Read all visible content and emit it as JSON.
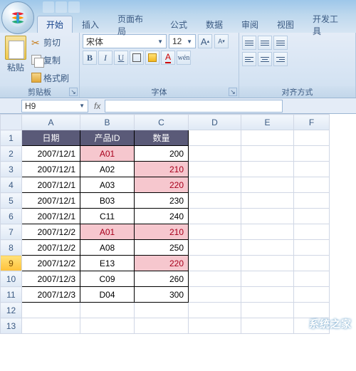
{
  "tabs": [
    "开始",
    "插入",
    "页面布局",
    "公式",
    "数据",
    "审阅",
    "视图",
    "开发工具"
  ],
  "activeTab": 0,
  "clipboard": {
    "paste": "粘贴",
    "cut": "剪切",
    "copy": "复制",
    "fmt": "格式刷",
    "group": "剪贴板"
  },
  "font": {
    "name": "宋体",
    "size": "12",
    "group": "字体",
    "bold": "B",
    "italic": "I",
    "underline": "U",
    "wen": "wén"
  },
  "align": {
    "group": "对齐方式"
  },
  "namebox": "H9",
  "fx": "fx",
  "columns": [
    "A",
    "B",
    "C",
    "D",
    "E",
    "F"
  ],
  "header": {
    "a": "日期",
    "b": "产品ID",
    "c": "数量"
  },
  "rows": [
    {
      "n": 1,
      "hdr": true
    },
    {
      "n": 2,
      "a": "2007/12/1",
      "b": "A01",
      "c": "200",
      "bp": true
    },
    {
      "n": 3,
      "a": "2007/12/1",
      "b": "A02",
      "c": "210",
      "cp": true
    },
    {
      "n": 4,
      "a": "2007/12/1",
      "b": "A03",
      "c": "220",
      "cp": true
    },
    {
      "n": 5,
      "a": "2007/12/1",
      "b": "B03",
      "c": "230"
    },
    {
      "n": 6,
      "a": "2007/12/1",
      "b": "C11",
      "c": "240"
    },
    {
      "n": 7,
      "a": "2007/12/2",
      "b": "A01",
      "c": "210",
      "bp": true,
      "cp": true
    },
    {
      "n": 8,
      "a": "2007/12/2",
      "b": "A08",
      "c": "250"
    },
    {
      "n": 9,
      "a": "2007/12/2",
      "b": "E13",
      "c": "220",
      "cp": true,
      "sel": true
    },
    {
      "n": 10,
      "a": "2007/12/3",
      "b": "C09",
      "c": "260"
    },
    {
      "n": 11,
      "a": "2007/12/3",
      "b": "D04",
      "c": "300"
    },
    {
      "n": 12
    },
    {
      "n": 13
    }
  ],
  "watermark": "系统之家",
  "chart_data": {
    "type": "table",
    "columns": [
      "日期",
      "产品ID",
      "数量"
    ],
    "rows": [
      [
        "2007/12/1",
        "A01",
        200
      ],
      [
        "2007/12/1",
        "A02",
        210
      ],
      [
        "2007/12/1",
        "A03",
        220
      ],
      [
        "2007/12/1",
        "B03",
        230
      ],
      [
        "2007/12/1",
        "C11",
        240
      ],
      [
        "2007/12/2",
        "A01",
        210
      ],
      [
        "2007/12/2",
        "A08",
        250
      ],
      [
        "2007/12/2",
        "E13",
        220
      ],
      [
        "2007/12/3",
        "C09",
        260
      ],
      [
        "2007/12/3",
        "D04",
        300
      ]
    ]
  }
}
